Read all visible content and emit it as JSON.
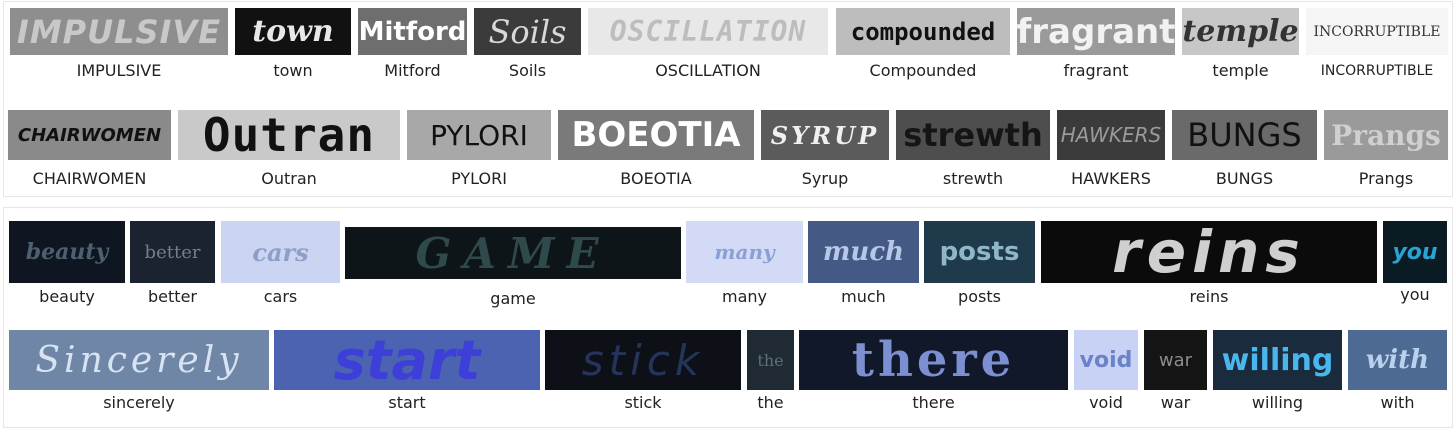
{
  "top_row_1": [
    {
      "label": "IMPULSIVE",
      "crop_text": "IMPULSIVE",
      "bg": "#8e8e8e",
      "fg": "#c8c8c8"
    },
    {
      "label": "town",
      "crop_text": "town",
      "bg": "#111111",
      "fg": "#e8e8e8"
    },
    {
      "label": "Mitford",
      "crop_text": "Mitford",
      "bg": "#6e6e6e",
      "fg": "#ffffff"
    },
    {
      "label": "Soils",
      "crop_text": "Soils",
      "bg": "#3b3b3b",
      "fg": "#d8d8d8"
    },
    {
      "label": "OSCILLATION",
      "crop_text": "OSCILLATION",
      "bg": "#e8e8e8",
      "fg": "#bdbdbd"
    },
    {
      "label": "Compounded",
      "crop_text": "compounded",
      "bg": "#bdbdbd",
      "fg": "#111111"
    },
    {
      "label": "fragrant",
      "crop_text": "fragrant",
      "bg": "#9a9a9a",
      "fg": "#f2f2f2"
    },
    {
      "label": "temple",
      "crop_text": "temple",
      "bg": "#c7c7c7",
      "fg": "#333333"
    },
    {
      "label": "INCORRUPTIBLE",
      "crop_text": "INCORRUPTIBLE",
      "bg": "#f5f5f5",
      "fg": "#333333"
    }
  ],
  "top_row_2": [
    {
      "label": "CHAIRWOMEN",
      "crop_text": "CHAIRWOMEN",
      "bg": "#8a8a8a",
      "fg": "#111111"
    },
    {
      "label": "Outran",
      "crop_text": "Outran",
      "bg": "#c9c9c9",
      "fg": "#111111"
    },
    {
      "label": "PYLORI",
      "crop_text": "PYLORI",
      "bg": "#a8a8a8",
      "fg": "#111111"
    },
    {
      "label": "BOEOTIA",
      "crop_text": "BOEOTIA",
      "bg": "#7a7a7a",
      "fg": "#ffffff"
    },
    {
      "label": "Syrup",
      "crop_text": "SYRUP",
      "bg": "#5b5b5b",
      "fg": "#f0f0f0"
    },
    {
      "label": "strewth",
      "crop_text": "strewth",
      "bg": "#4e4e4e",
      "fg": "#151515"
    },
    {
      "label": "HAWKERS",
      "crop_text": "HAWKERS",
      "bg": "#3b3b3b",
      "fg": "#9a9a9a"
    },
    {
      "label": "BUNGS",
      "crop_text": "BUNGS",
      "bg": "#6a6a6a",
      "fg": "#111111"
    },
    {
      "label": "Prangs",
      "crop_text": "Prangs",
      "bg": "#9a9a9a",
      "fg": "#d0d0d0"
    }
  ],
  "bottom_row_1": [
    {
      "label": "beauty",
      "crop_text": "beauty",
      "bg": "#101621",
      "fg": "#4d6070"
    },
    {
      "label": "better",
      "crop_text": "better",
      "bg": "#1b2330",
      "fg": "#6f7f8f"
    },
    {
      "label": "cars",
      "crop_text": "cars",
      "bg": "#cbd4f0",
      "fg": "#8f9dc9"
    },
    {
      "label": "game",
      "crop_text": "GAME",
      "bg": "#0e1518",
      "fg": "#2f4a4a"
    },
    {
      "label": "many",
      "crop_text": "many",
      "bg": "#d2daf5",
      "fg": "#8aa0d5"
    },
    {
      "label": "much",
      "crop_text": "much",
      "bg": "#445a84",
      "fg": "#b7c7e8"
    },
    {
      "label": "posts",
      "crop_text": "posts",
      "bg": "#1f3a4a",
      "fg": "#8fb7c9"
    },
    {
      "label": "reins",
      "crop_text": "reins",
      "bg": "#0b0b0b",
      "fg": "#cfcfcf"
    },
    {
      "label": "you",
      "crop_text": "you",
      "bg": "#0b1b24",
      "fg": "#2aa3d4"
    }
  ],
  "bottom_row_2": [
    {
      "label": "sincerely",
      "crop_text": "Sincerely",
      "bg": "#6f86a7",
      "fg": "#d7e3f2"
    },
    {
      "label": "start",
      "crop_text": "start",
      "bg": "#4b63b0",
      "fg": "#3d3fd8"
    },
    {
      "label": "stick",
      "crop_text": "stick",
      "bg": "#0d1016",
      "fg": "#24345a"
    },
    {
      "label": "the",
      "crop_text": "the",
      "bg": "#1f2a35",
      "fg": "#5f6f7a"
    },
    {
      "label": "there",
      "crop_text": "there",
      "bg": "#11182a",
      "fg": "#7c8fd0"
    },
    {
      "label": "void",
      "crop_text": "void",
      "bg": "#c7d2f4",
      "fg": "#6b82c9"
    },
    {
      "label": "war",
      "crop_text": "war",
      "bg": "#141414",
      "fg": "#8c8c8c"
    },
    {
      "label": "willing",
      "crop_text": "willing",
      "bg": "#1a2b3d",
      "fg": "#4ab6ee"
    },
    {
      "label": "with",
      "crop_text": "with",
      "bg": "#4d6b92",
      "fg": "#b9d0ee"
    }
  ]
}
